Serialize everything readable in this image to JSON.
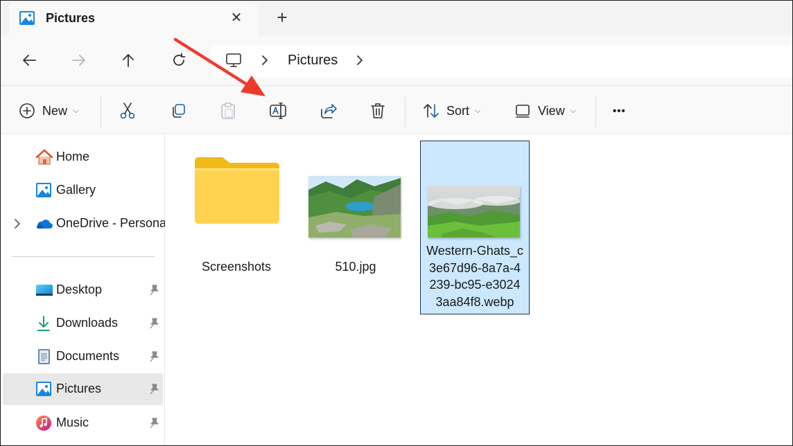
{
  "window": {
    "tab_title": "Pictures",
    "close_glyph": "✕",
    "new_tab_glyph": "+"
  },
  "address": {
    "segment": "Pictures"
  },
  "toolbar": {
    "new_label": "New",
    "sort_label": "Sort",
    "view_label": "View",
    "more_glyph": "•••",
    "caret": "⌵"
  },
  "sidebar": {
    "items": [
      {
        "label": "Home",
        "icon": "home-icon"
      },
      {
        "label": "Gallery",
        "icon": "gallery-icon"
      },
      {
        "label": "OneDrive - Persona",
        "icon": "onedrive-icon"
      },
      {
        "label": "Desktop",
        "icon": "desktop-icon",
        "pinned": true
      },
      {
        "label": "Downloads",
        "icon": "downloads-icon",
        "pinned": true
      },
      {
        "label": "Documents",
        "icon": "documents-icon",
        "pinned": true
      },
      {
        "label": "Pictures",
        "icon": "pictures-icon",
        "pinned": true,
        "selected": true
      },
      {
        "label": "Music",
        "icon": "music-icon",
        "pinned": true
      }
    ]
  },
  "files": [
    {
      "name": "Screenshots",
      "type": "folder"
    },
    {
      "name": "510.jpg",
      "type": "image"
    },
    {
      "name_lines": [
        "Western-Ghats_c",
        "3e67d96-8a7a-4",
        "239-bc95-e3024",
        "3aa84f8.webp"
      ],
      "type": "image",
      "selected": true
    }
  ],
  "annotation": {
    "arrow_color": "#ef3b2d",
    "points_to": "rename-button"
  },
  "colors": {
    "selection_bg": "#cce8ff",
    "folder_yellow": "#ffd34f",
    "accent_blue": "#0067c0"
  }
}
